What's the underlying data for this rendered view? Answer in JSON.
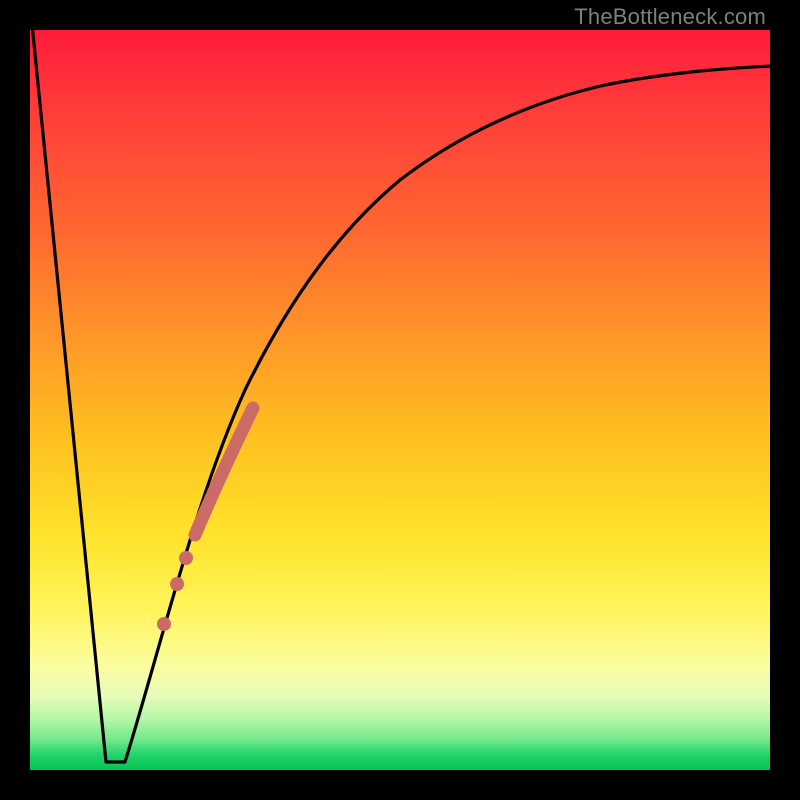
{
  "attribution": "TheBottleneck.com",
  "chart_data": {
    "type": "line",
    "title": "",
    "xlabel": "",
    "ylabel": "",
    "xlim": [
      0,
      100
    ],
    "ylim": [
      0,
      100
    ],
    "series": [
      {
        "name": "left-falling-line",
        "x": [
          0,
          10
        ],
        "values": [
          100,
          1
        ]
      },
      {
        "name": "valley-floor",
        "x": [
          10,
          13
        ],
        "values": [
          1,
          1
        ]
      },
      {
        "name": "rising-saturating-curve",
        "x": [
          13,
          16,
          20,
          24,
          28,
          32,
          36,
          40,
          45,
          50,
          55,
          60,
          65,
          70,
          75,
          80,
          85,
          90,
          95,
          100
        ],
        "values": [
          1,
          12,
          25,
          36,
          45,
          53,
          60,
          66,
          72,
          77,
          81,
          84,
          87,
          89,
          90.5,
          92,
          93,
          93.8,
          94.3,
          94.6
        ]
      },
      {
        "name": "overlay-thick-segment",
        "x": [
          22,
          30
        ],
        "values": [
          31,
          49
        ]
      },
      {
        "name": "overlay-dot-1",
        "x": [
          20.5
        ],
        "values": [
          27
        ]
      },
      {
        "name": "overlay-dot-2",
        "x": [
          19.2
        ],
        "values": [
          23
        ]
      },
      {
        "name": "overlay-dot-3",
        "x": [
          17.6
        ],
        "values": [
          17.5
        ]
      }
    ],
    "background_gradient": {
      "top": "#ff1b3a",
      "mid_upper": "#ff9828",
      "mid": "#ffe22a",
      "mid_lower": "#fbfda0",
      "bottom": "#06c455"
    },
    "overlay_color": "#cc6a66"
  }
}
